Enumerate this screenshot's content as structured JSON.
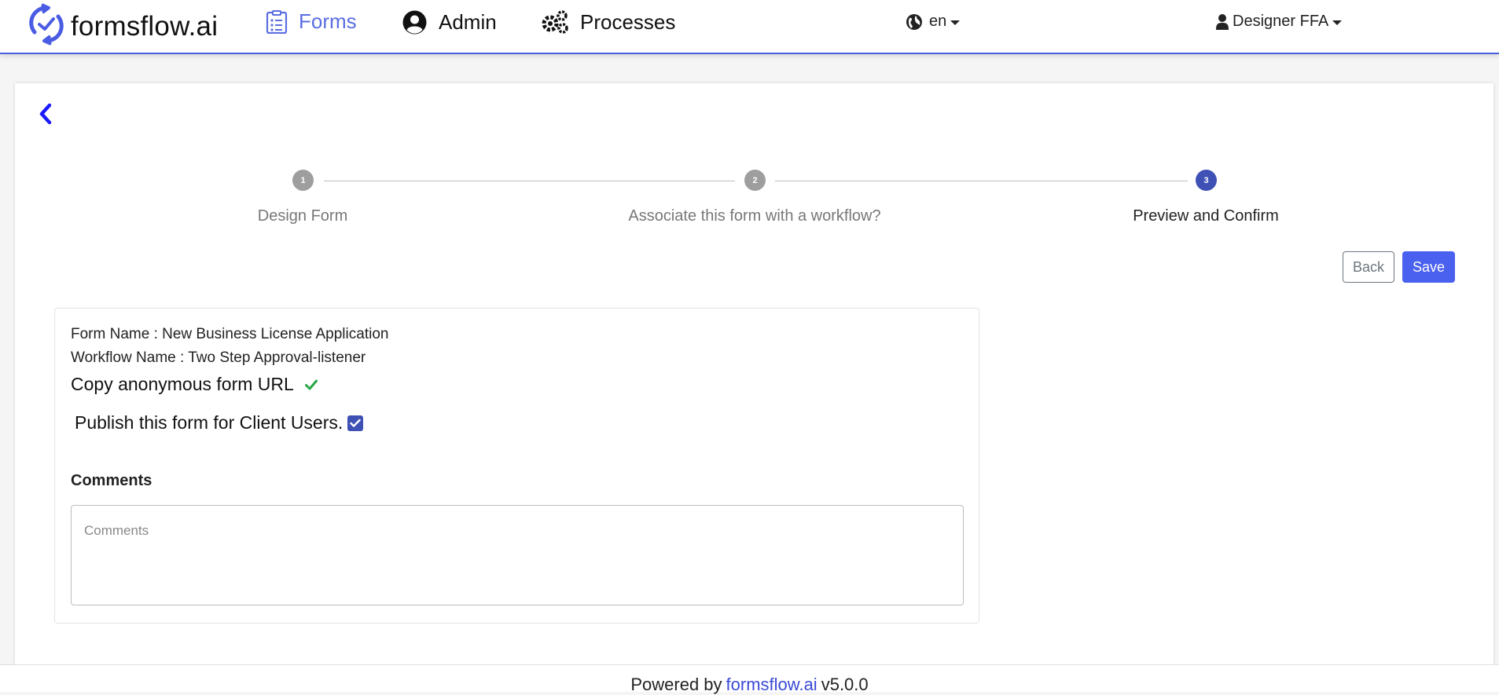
{
  "brand": {
    "name": "formsflow.ai",
    "logo_icon": "formsflow-sync-check-logo"
  },
  "nav": {
    "forms": {
      "label": "Forms",
      "icon": "clipboard-list-icon"
    },
    "admin": {
      "label": "Admin",
      "icon": "user-circle-icon"
    },
    "processes": {
      "label": "Processes",
      "icon": "cogs-icon"
    },
    "language": {
      "label": "en",
      "icon": "globe-icon"
    },
    "user": {
      "label": "Designer FFA",
      "icon": "user-icon"
    }
  },
  "stepper": {
    "steps": [
      {
        "number": "1",
        "label": "Design Form",
        "state": "completed"
      },
      {
        "number": "2",
        "label": "Associate this form with a workflow?",
        "state": "completed"
      },
      {
        "number": "3",
        "label": "Preview and Confirm",
        "state": "active"
      }
    ]
  },
  "actions": {
    "back_label": "Back",
    "save_label": "Save"
  },
  "summary": {
    "form_name_line": "Form Name : New Business License Application",
    "workflow_name_line": "Workflow Name : Two Step Approval-listener",
    "copy_url_label": "Copy anonymous form URL",
    "copy_url_icon": "check-icon",
    "publish_label": "Publish this form for Client Users.",
    "publish_checked": true
  },
  "comments": {
    "label": "Comments",
    "placeholder": "Comments",
    "value": ""
  },
  "footer": {
    "prefix": "Powered by",
    "link": "formsflow.ai",
    "version": "v5.0.0"
  },
  "colors": {
    "accent": "#4a5ce3",
    "primary_button": "#4a60ef",
    "step_active": "#3f51b5",
    "step_inactive": "#9e9e9e",
    "success": "#28a745"
  }
}
